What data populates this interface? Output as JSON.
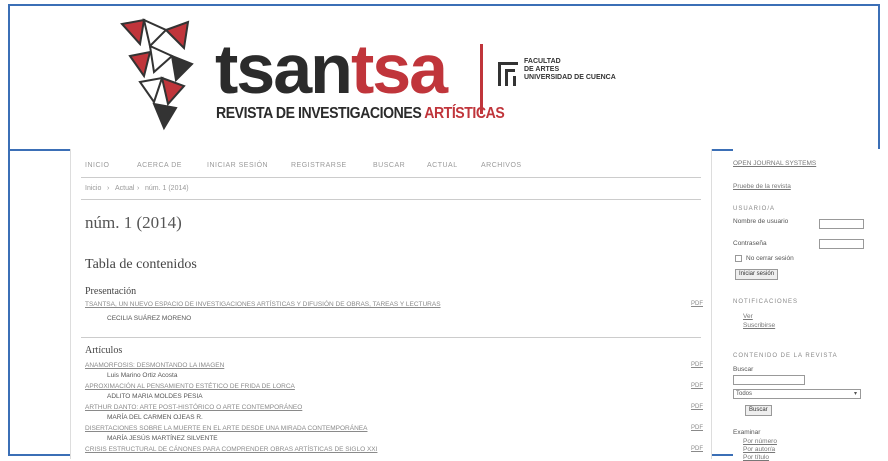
{
  "header": {
    "brand_part1": "tsan",
    "brand_part2": "tsa",
    "subtitle_main": "REVISTA DE INVESTIGACIONES ",
    "subtitle_red": "ARTÍSTICAS",
    "faculty_lines": [
      "FACULTAD",
      "DE ARTES",
      "UNIVERSIDAD DE CUENCA"
    ]
  },
  "nav": {
    "items": [
      "INICIO",
      "ACERCA DE",
      "INICIAR SESIÓN",
      "REGISTRARSE",
      "BUSCAR",
      "ACTUAL",
      "ARCHIVOS"
    ]
  },
  "breadcrumb": {
    "items": [
      "Inicio",
      "Actual",
      "núm. 1 (2014)"
    ],
    "separator": "›"
  },
  "issue": {
    "title": "núm. 1 (2014)",
    "toc_title": "Tabla de contenidos",
    "sections": [
      {
        "name": "Presentación",
        "articles": [
          {
            "title": "TSANTSA, UN NUEVO ESPACIO DE INVESTIGACIONES ARTÍSTICAS Y DIFUSIÓN DE OBRAS, TAREAS Y LECTURAS",
            "author": "CECILIA SUÁREZ MORENO",
            "file": "PDF"
          }
        ]
      },
      {
        "name": "Artículos",
        "articles": [
          {
            "title": "ANAMORFOSIS: DESMONTANDO LA IMAGEN",
            "author": "Luis Marino Ortiz Acosta",
            "file": "PDF"
          },
          {
            "title": "APROXIMACIÓN AL PENSAMIENTO ESTÉTICO DE FRIDA DE LORCA",
            "author": "ADLITO MARIA MOLDES PESIA",
            "file": "PDF"
          },
          {
            "title": "ARTHUR DANTO: ARTE POST-HISTÓRICO O ARTE CONTEMPORÁNEO",
            "author": "MARÍA DEL CARMEN OJEAS R.",
            "file": "PDF"
          },
          {
            "title": "DISERTACIONES SOBRE LA MUERTE EN EL ARTE DESDE UNA MIRADA CONTEMPORÁNEA",
            "author": "MARÍA JESÚS MARTÍNEZ SILVENTE",
            "file": "PDF"
          },
          {
            "title": "CRISIS ESTRUCTURAL DE CÁNONES PARA COMPRENDER OBRAS ARTÍSTICAS DE SIGLO XXI",
            "author": "",
            "file": "PDF"
          }
        ]
      }
    ]
  },
  "sidebar": {
    "oj_link": "OPEN JOURNAL SYSTEMS",
    "profile_link": "Pruebe de la revista",
    "user_head": "USUARIO/A",
    "username_label": "Nombre de usuario",
    "password_label": "Contraseña",
    "remember_label": "No cerrar sesión",
    "login_button": "Iniciar sesión",
    "notif_head": "NOTIFICACIONES",
    "notif_items": [
      "Ver",
      "Suscribirse"
    ],
    "content_head": "CONTENIDO DE LA REVISTA",
    "search_label": "Buscar",
    "search_select": "Todos",
    "search_button": "Buscar",
    "browse_label": "Examinar",
    "browse_items": [
      "Por número",
      "Por autor/a",
      "Por título"
    ]
  }
}
